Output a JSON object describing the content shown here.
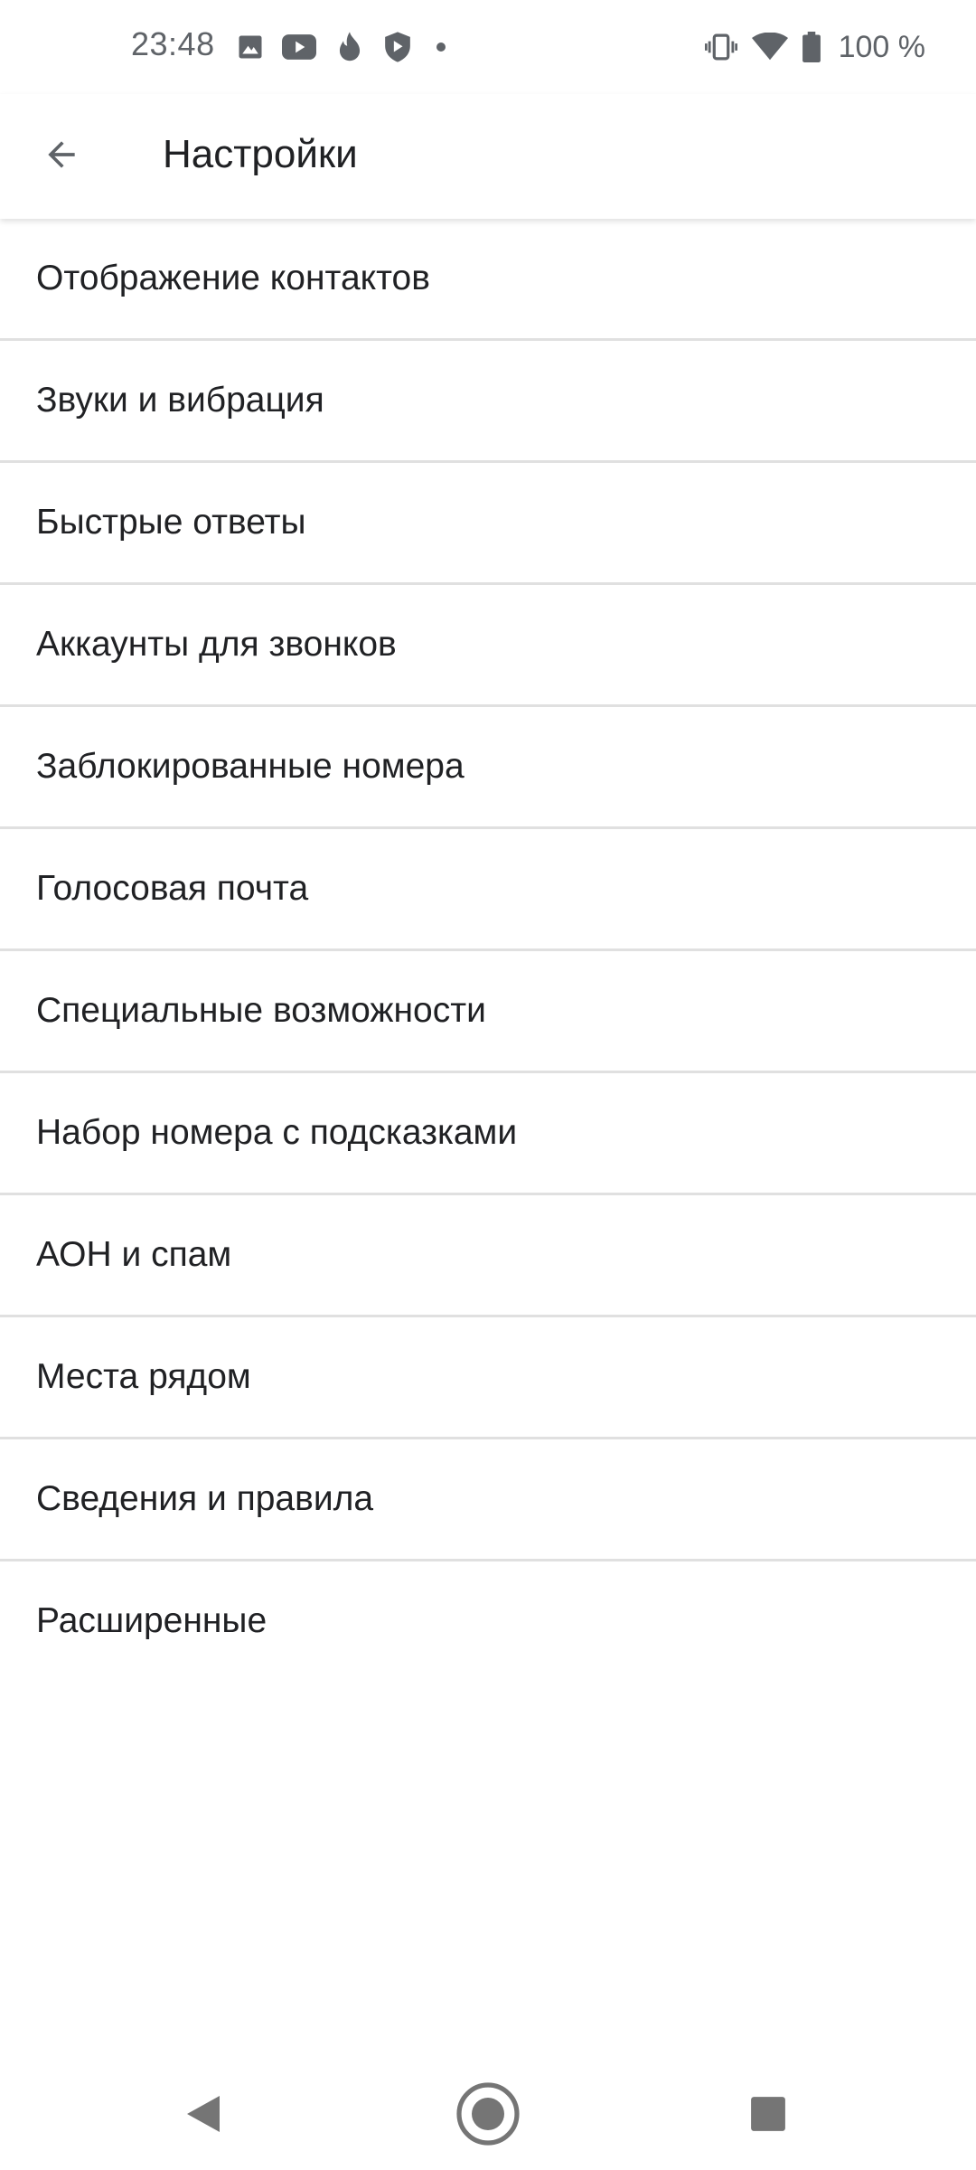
{
  "status_bar": {
    "time": "23:48",
    "left_icons": [
      "image-icon",
      "youtube-icon",
      "fire-icon",
      "shield-play-icon",
      "dot-icon"
    ],
    "right_icons": [
      "vibrate-icon",
      "wifi-icon",
      "battery-icon"
    ],
    "battery_text": "100 %"
  },
  "app_bar": {
    "back_icon": "arrow-back-icon",
    "title": "Настройки"
  },
  "settings": {
    "items": [
      {
        "label": "Отображение контактов"
      },
      {
        "label": "Звуки и вибрация"
      },
      {
        "label": "Быстрые ответы"
      },
      {
        "label": "Аккаунты для звонков"
      },
      {
        "label": "Заблокированные номера"
      },
      {
        "label": "Голосовая почта"
      },
      {
        "label": "Специальные возможности"
      },
      {
        "label": "Набор номера с подсказками"
      },
      {
        "label": "АОН и спам"
      },
      {
        "label": "Места рядом"
      },
      {
        "label": "Сведения и правила"
      },
      {
        "label": "Расширенные"
      }
    ]
  },
  "nav_bar": {
    "icons": [
      "nav-back-icon",
      "nav-home-icon",
      "nav-recents-icon"
    ]
  },
  "colors": {
    "text_primary": "#202124",
    "text_secondary": "#5f6368",
    "divider": "#e0e0e0",
    "background": "#ffffff"
  }
}
